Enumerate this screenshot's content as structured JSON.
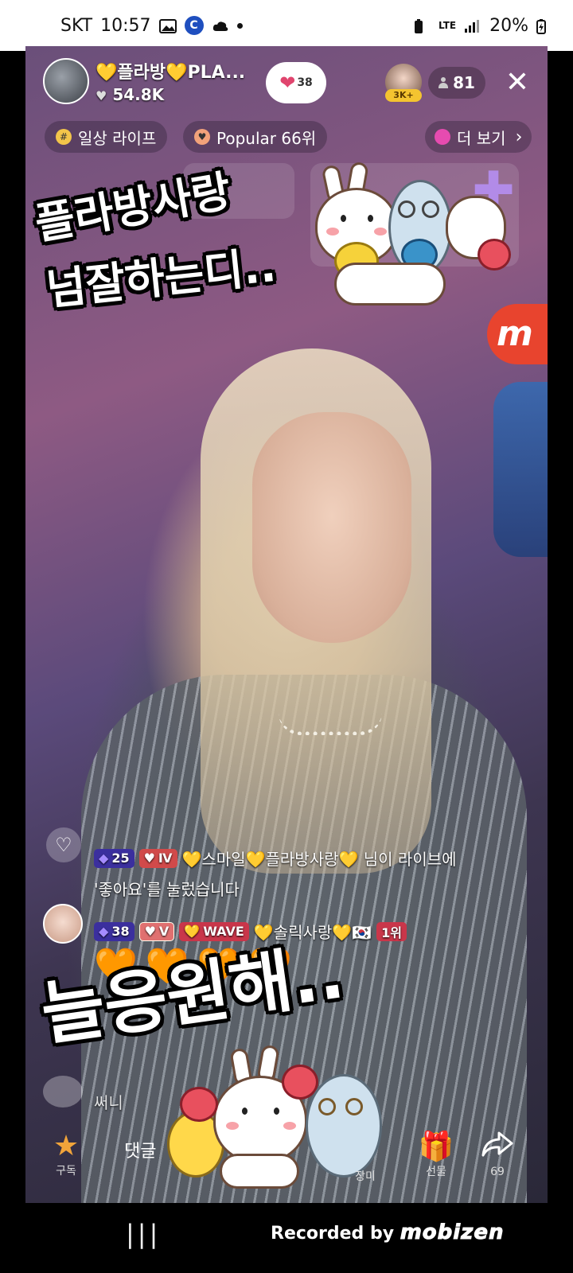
{
  "status_bar": {
    "carrier": "SKT",
    "time": "10:57",
    "network": "LTE",
    "battery": "20%"
  },
  "live": {
    "host_name": "💛플라방💛PLA...",
    "host_likes": "54.8K",
    "gift_count": "38",
    "top_viewer_badge": "3K+",
    "viewer_count": "81",
    "close_icon": "close-icon"
  },
  "chips": {
    "daily": "일상 라이프",
    "popular": "Popular 66위",
    "more": "더 보기"
  },
  "stickers": {
    "line1": "플라방사랑",
    "line2": "넘잘하는디..",
    "big": "늘응원해.."
  },
  "side": {
    "m_label": "m"
  },
  "chat": {
    "msg1": {
      "level": "25",
      "rank": "Ⅳ",
      "text": "💛스마일💛플라방사랑💛 님이 라이브에",
      "text2": "'좋아요'를 눌렀습니다"
    },
    "msg2": {
      "level": "38",
      "rank": "Ⅴ",
      "wave": "WAVE",
      "name": "💛솔릭사랑💛🇰🇷",
      "first": "1위",
      "hearts": "🧡🧡🧡🧡"
    },
    "msg3": {
      "text": "써니"
    }
  },
  "bottom_bar": {
    "subscribe": "구독",
    "comment": "댓글",
    "like": "장미",
    "gift": "선물",
    "share_count": "69"
  },
  "system_nav": {
    "recorded_by": "Recorded by",
    "brand": "mobizen"
  }
}
